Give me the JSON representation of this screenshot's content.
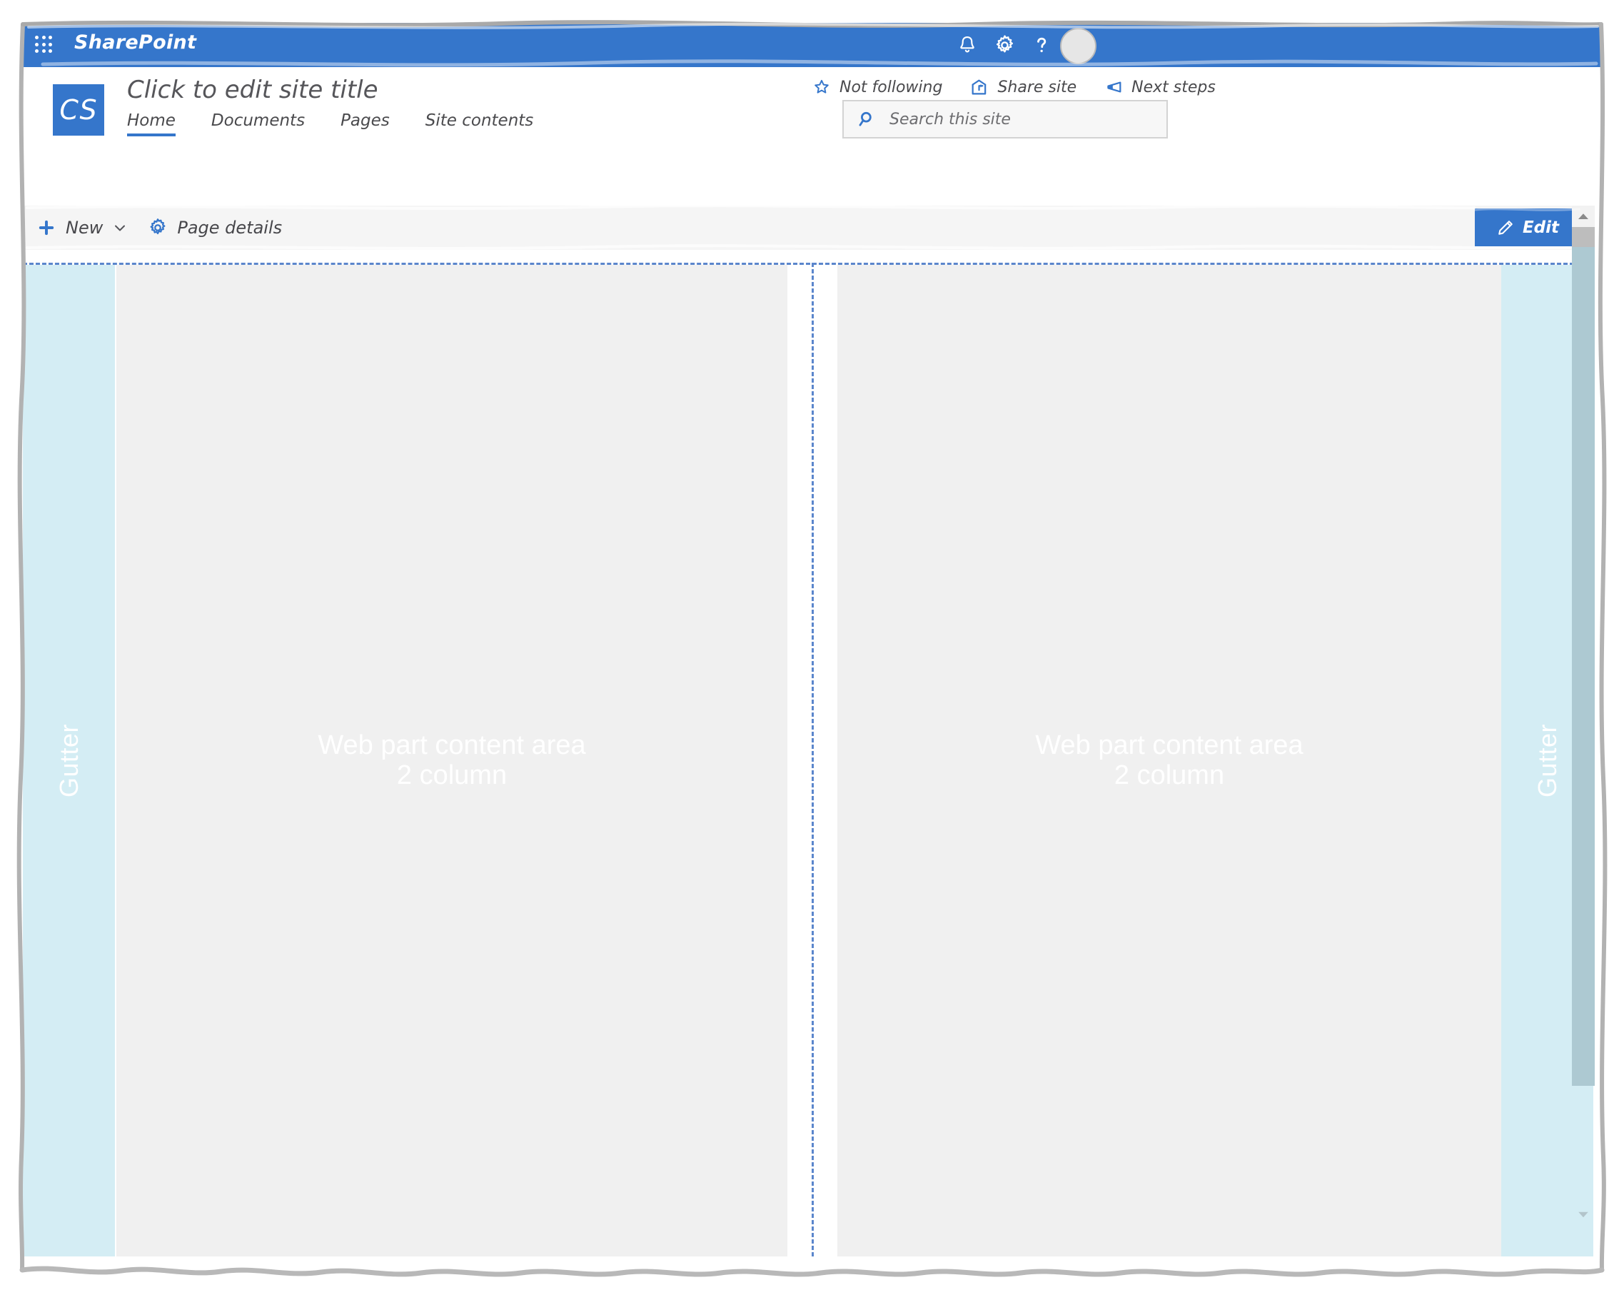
{
  "theme": {
    "brand_blue": "#3576cb",
    "gutter_blue": "#d4edf4",
    "content_gray": "#f0f0f0",
    "command_bar_gray": "#f5f5f5",
    "dash_blue": "#5b86cc",
    "text_gray": "#4a4a4d"
  },
  "suite_bar": {
    "waffle_icon": "app-launcher-waffle-icon",
    "brand": "SharePoint",
    "icons": [
      {
        "name": "notifications-bell-icon",
        "label": "Notifications"
      },
      {
        "name": "settings-gear-icon",
        "label": "Settings"
      },
      {
        "name": "help-question-icon",
        "label": "Help"
      }
    ],
    "avatar": "user-avatar"
  },
  "site_header": {
    "logo_initials": "CS",
    "title": "Click to edit site title",
    "nav": [
      {
        "label": "Home",
        "active": true
      },
      {
        "label": "Documents",
        "active": false
      },
      {
        "label": "Pages",
        "active": false
      },
      {
        "label": "Site contents",
        "active": false
      }
    ],
    "actions": [
      {
        "icon": "star-outline-icon",
        "label": "Not following"
      },
      {
        "icon": "share-site-icon",
        "label": "Share site"
      },
      {
        "icon": "megaphone-icon",
        "label": "Next steps"
      }
    ],
    "search": {
      "icon": "search-magnifier-icon",
      "placeholder": "Search this site",
      "value": ""
    }
  },
  "command_bar": {
    "items": [
      {
        "icon": "plus-icon",
        "label": "New",
        "chevron": "chevron-down-icon"
      },
      {
        "icon": "page-details-gear-icon",
        "label": "Page details"
      }
    ],
    "edit": {
      "icon": "pencil-edit-icon",
      "label": "Edit"
    }
  },
  "canvas": {
    "gutter_left_label": "Gutter",
    "gutter_right_label": "Gutter",
    "columns": [
      {
        "line1": "Web part content area",
        "line2": "2 column"
      },
      {
        "line1": "Web part content area",
        "line2": "2 column"
      }
    ]
  },
  "scrollbar": {
    "up_arrow": "scroll-up-arrow-icon",
    "down_arrow": "scroll-down-arrow-icon"
  }
}
